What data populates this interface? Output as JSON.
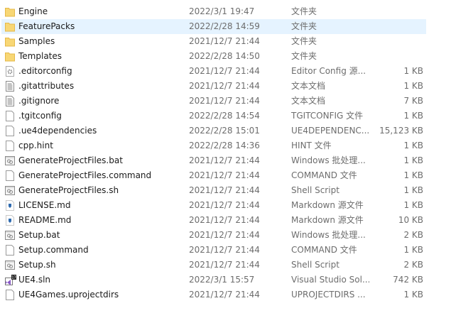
{
  "files": [
    {
      "name": "Engine",
      "date": "2022/3/1 19:47",
      "type": "文件夹",
      "size": "",
      "icon": "folder-icon"
    },
    {
      "name": "FeaturePacks",
      "date": "2022/2/28 14:59",
      "type": "文件夹",
      "size": "",
      "icon": "folder-icon",
      "hovered": true
    },
    {
      "name": "Samples",
      "date": "2021/12/7 21:44",
      "type": "文件夹",
      "size": "",
      "icon": "folder-icon"
    },
    {
      "name": "Templates",
      "date": "2022/2/28 14:50",
      "type": "文件夹",
      "size": "",
      "icon": "folder-icon"
    },
    {
      "name": ".editorconfig",
      "date": "2021/12/7 21:44",
      "type": "Editor Config 源...",
      "size": "1 KB",
      "icon": "config-file-icon"
    },
    {
      "name": ".gitattributes",
      "date": "2021/12/7 21:44",
      "type": "文本文档",
      "size": "1 KB",
      "icon": "text-file-icon"
    },
    {
      "name": ".gitignore",
      "date": "2021/12/7 21:44",
      "type": "文本文档",
      "size": "7 KB",
      "icon": "text-file-icon"
    },
    {
      "name": ".tgitconfig",
      "date": "2022/2/28 14:54",
      "type": "TGITCONFIG 文件",
      "size": "1 KB",
      "icon": "file-icon"
    },
    {
      "name": ".ue4dependencies",
      "date": "2022/2/28 15:01",
      "type": "UE4DEPENDENC...",
      "size": "15,123 KB",
      "icon": "file-icon"
    },
    {
      "name": "cpp.hint",
      "date": "2022/2/28 14:36",
      "type": "HINT 文件",
      "size": "1 KB",
      "icon": "file-icon"
    },
    {
      "name": "GenerateProjectFiles.bat",
      "date": "2021/12/7 21:44",
      "type": "Windows 批处理...",
      "size": "1 KB",
      "icon": "script-file-icon"
    },
    {
      "name": "GenerateProjectFiles.command",
      "date": "2021/12/7 21:44",
      "type": "COMMAND 文件",
      "size": "1 KB",
      "icon": "file-icon"
    },
    {
      "name": "GenerateProjectFiles.sh",
      "date": "2021/12/7 21:44",
      "type": "Shell Script",
      "size": "1 KB",
      "icon": "script-file-icon"
    },
    {
      "name": "LICENSE.md",
      "date": "2021/12/7 21:44",
      "type": "Markdown 源文件",
      "size": "1 KB",
      "icon": "markdown-file-icon"
    },
    {
      "name": "README.md",
      "date": "2021/12/7 21:44",
      "type": "Markdown 源文件",
      "size": "10 KB",
      "icon": "markdown-file-icon"
    },
    {
      "name": "Setup.bat",
      "date": "2021/12/7 21:44",
      "type": "Windows 批处理...",
      "size": "2 KB",
      "icon": "script-file-icon"
    },
    {
      "name": "Setup.command",
      "date": "2021/12/7 21:44",
      "type": "COMMAND 文件",
      "size": "1 KB",
      "icon": "file-icon"
    },
    {
      "name": "Setup.sh",
      "date": "2021/12/7 21:44",
      "type": "Shell Script",
      "size": "2 KB",
      "icon": "script-file-icon"
    },
    {
      "name": "UE4.sln",
      "date": "2022/3/1 15:57",
      "type": "Visual Studio Sol...",
      "size": "742 KB",
      "icon": "visual-studio-solution-icon"
    },
    {
      "name": "UE4Games.uprojectdirs",
      "date": "2021/12/7 21:44",
      "type": "UPROJECTDIRS ...",
      "size": "1 KB",
      "icon": "file-icon"
    }
  ],
  "colors": {
    "hover": "#e5f3ff",
    "folder": "#f8d775",
    "name_text": "#1a1a1a",
    "meta_text": "#6d6d6d"
  }
}
